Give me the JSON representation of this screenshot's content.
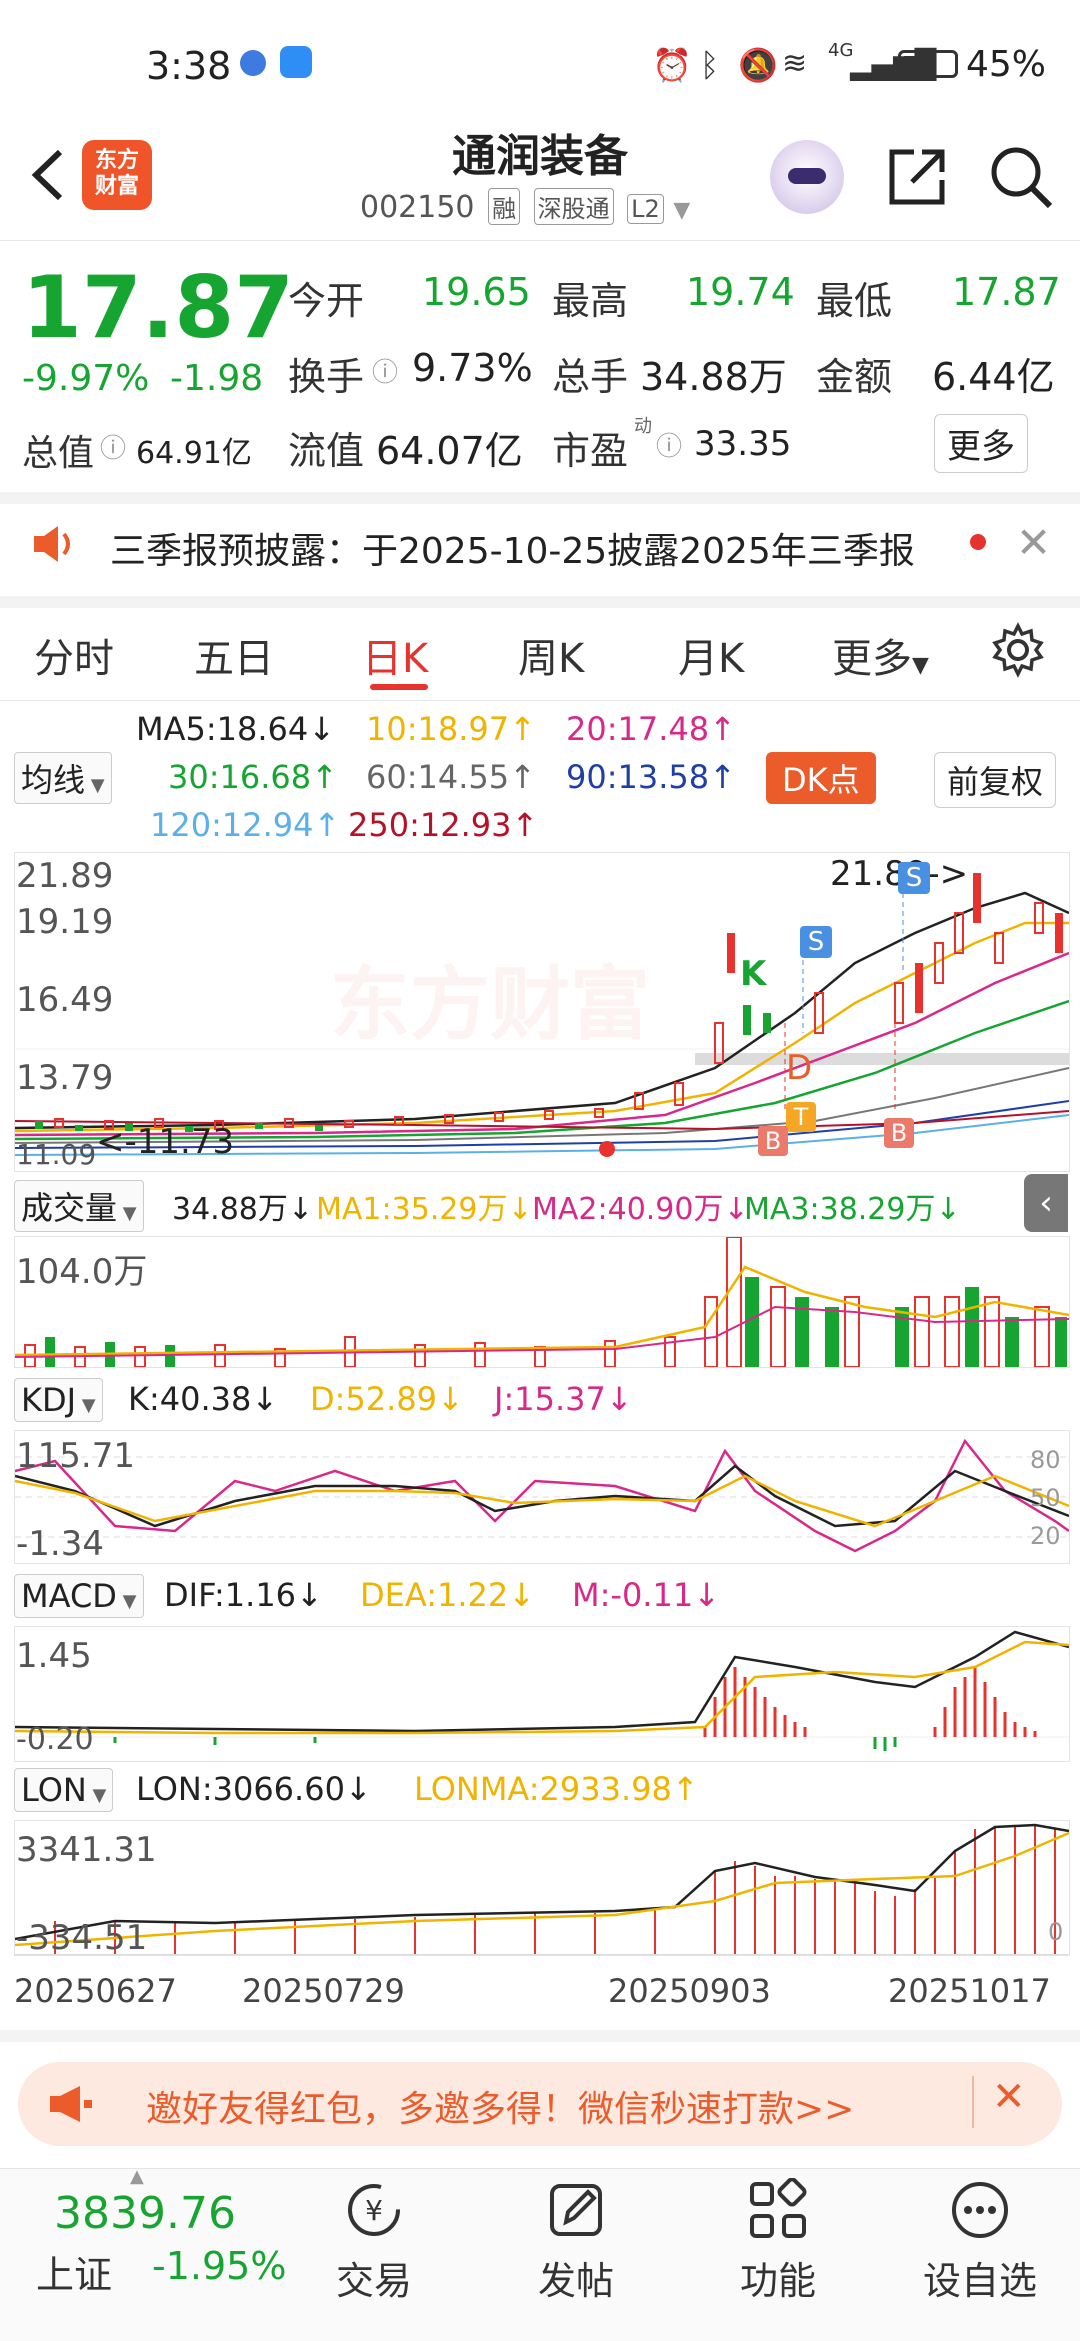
{
  "status": {
    "time": "3:38",
    "network": "4G",
    "battery": "45%"
  },
  "header": {
    "logo_line1": "东方",
    "logo_line2": "财富",
    "stock_name": "通润装备",
    "stock_code": "002150",
    "tags": [
      "融",
      "深股通",
      "L2"
    ]
  },
  "quote": {
    "price": "17.87",
    "change_pct": "-9.97%",
    "change": "-1.98",
    "open_label": "今开",
    "open": "19.65",
    "high_label": "最高",
    "high": "19.74",
    "low_label": "最低",
    "low": "17.87",
    "turnover_label": "换手",
    "turnover": "9.73%",
    "volume_label": "总手",
    "volume": "34.88万",
    "amount_label": "金额",
    "amount": "6.44亿",
    "mktcap_label": "总值",
    "mktcap": "64.91亿",
    "float_label": "流值",
    "float": "64.07亿",
    "pe_label": "市盈",
    "pe_sup": "动",
    "pe": "33.35",
    "more": "更多"
  },
  "notice": {
    "text": "三季报预披露：于2025-10-25披露2025年三季报"
  },
  "tabs": [
    "分时",
    "五日",
    "日K",
    "周K",
    "月K",
    "更多"
  ],
  "active_tab": "日K",
  "ma_legend": {
    "selector": "均线",
    "ma5": "MA5:18.64↓",
    "ma10": "10:18.97↑",
    "ma20": "20:17.48↑",
    "ma30": "30:16.68↑",
    "ma60": "60:14.55↑",
    "ma90": "90:13.58↑",
    "ma120": "120:12.94↑",
    "ma250": "250:12.93↑",
    "dk_button": "DK点",
    "adjust_button": "前复权"
  },
  "kline": {
    "y_labels": [
      "21.89",
      "19.19",
      "16.49",
      "13.79",
      "11.09"
    ],
    "watermark": "东方财富",
    "high_mark": "21.89->",
    "low_mark": "<-11.73",
    "markers": [
      "K",
      "S",
      "S",
      "D",
      "T",
      "B",
      "B"
    ]
  },
  "volume": {
    "selector": "成交量",
    "value": "34.88万↓",
    "ma1": "MA1:35.29万↓",
    "ma2": "MA2:40.90万↓",
    "ma3": "MA3:38.29万↓",
    "y_label": "104.0万"
  },
  "kdj": {
    "selector": "KDJ",
    "k": "K:40.38↓",
    "d": "D:52.89↓",
    "j": "J:15.37↓",
    "y_top": "115.71",
    "y_bottom": "-1.34",
    "levels": [
      "80",
      "50",
      "20"
    ]
  },
  "macd": {
    "selector": "MACD",
    "dif": "DIF:1.16↓",
    "dea": "DEA:1.22↓",
    "m": "M:-0.11↓",
    "y_top": "1.45",
    "y_bottom": "-0.20"
  },
  "lon": {
    "selector": "LON",
    "lon": "LON:3066.60↓",
    "lonma": "LONMA:2933.98↑",
    "y_top": "3341.31",
    "y_bottom": "-334.51",
    "zero": "0"
  },
  "dates": [
    "20250627",
    "20250729",
    "20250903",
    "20251017"
  ],
  "banner": {
    "text": "邀好友得红包，多邀多得！微信秒速打款>>"
  },
  "bottom": {
    "index_value": "3839.76",
    "index_name": "上证",
    "index_change": "-1.95%",
    "items": [
      "交易",
      "发帖",
      "功能",
      "设自选"
    ]
  },
  "colors": {
    "up": "#e8322e",
    "down": "#17a531",
    "accent": "#ec5b2a"
  }
}
